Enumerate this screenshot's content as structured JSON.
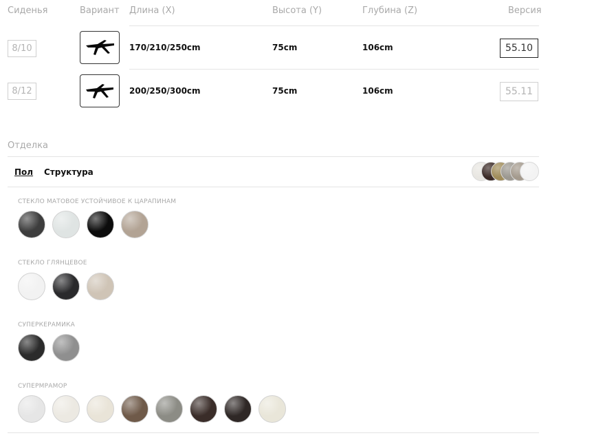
{
  "headers": {
    "seats": "Сиденья",
    "variant": "Вариант",
    "length": "Длина (X)",
    "height": "Высота (Y)",
    "depth": "Глубина (Z)",
    "version": "Версия"
  },
  "rows": [
    {
      "seats": "8/10",
      "length": "170/210/250cm",
      "height": "75cm",
      "depth": "106cm",
      "version": "55.10",
      "selected": true
    },
    {
      "seats": "8/12",
      "length": "200/250/300cm",
      "height": "75cm",
      "depth": "106cm",
      "version": "55.11",
      "selected": false
    }
  ],
  "finish": {
    "title": "Отделка",
    "tabs": [
      "Пол",
      "Структура"
    ],
    "active_tab": "Пол",
    "stack_colors": [
      "#e8e6e1",
      "#3b2a26",
      "#a08c5a",
      "#9c9890",
      "#a49a8d",
      "#f3f3f3"
    ],
    "categories": [
      {
        "name": "СТЕКЛО МАТОВОЕ УСТОЙЧИВОЕ К ЦАРАПИНАМ",
        "swatches": [
          "#3d3d3d",
          "#dfe4e3",
          "#0c0c0c",
          "#b2a394"
        ]
      },
      {
        "name": "СТЕКЛО ГЛЯНЦЕВОЕ",
        "swatches": [
          "#f2f2f2",
          "#2a2a2c",
          "#cfc4b6"
        ]
      },
      {
        "name": "СУПЕРКЕРАМИКА",
        "swatches": [
          "#2b2b2b",
          "#8f8f8f"
        ]
      },
      {
        "name": "СУПЕРМРАМОР",
        "swatches": [
          "#e6e6e6",
          "#ece9e2",
          "#e9e4d8",
          "#6f5a49",
          "#8c8c85",
          "#3a2d29",
          "#2f2826",
          "#e9e6d9"
        ]
      }
    ]
  }
}
